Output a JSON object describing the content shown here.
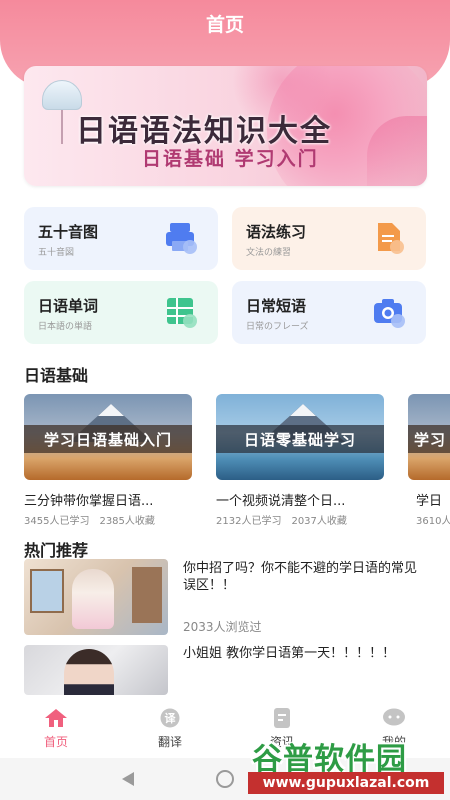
{
  "header": {
    "title": "首页"
  },
  "banner": {
    "title": "日语语法知识大全",
    "subtitle": "日语基础 学习入门"
  },
  "menu_cards": [
    {
      "title": "五十音图",
      "subtitle": "五十音図",
      "icon": "printer-icon",
      "bg": "#eef3fd",
      "color": "#4f7cf0"
    },
    {
      "title": "语法练习",
      "subtitle": "文法の練習",
      "icon": "document-icon",
      "bg": "#fdf1e8",
      "color": "#f39a4a"
    },
    {
      "title": "日语单词",
      "subtitle": "日本語の単語",
      "icon": "grid-icon",
      "bg": "#ebf9f3",
      "color": "#3fc48e"
    },
    {
      "title": "日常短语",
      "subtitle": "日常のフレーズ",
      "icon": "camera-icon",
      "bg": "#eef3fd",
      "color": "#4f7cf0"
    }
  ],
  "section_basics": {
    "title": "日语基础"
  },
  "courses": [
    {
      "banner": "学习日语基础入门",
      "title": "三分钟带你掌握日语...",
      "learners": "3455人已学习",
      "favorites": "2385人收藏"
    },
    {
      "banner": "日语零基础学习",
      "title": "一个视频说清整个日...",
      "learners": "2132人已学习",
      "favorites": "2037人收藏"
    },
    {
      "banner": "学习",
      "title": "学日",
      "learners": "3610人",
      "favorites": ""
    }
  ],
  "section_hot": {
    "title": "热门推荐"
  },
  "recommendations": [
    {
      "title": "你中招了吗？你不能不避的学日语的常见误区！！",
      "views": "2033人浏览过"
    },
    {
      "title": "小姐姐 教你学日语第一天！！！！！",
      "views": ""
    }
  ],
  "tabbar": [
    {
      "label": "首页",
      "icon": "home-icon",
      "active": true
    },
    {
      "label": "翻译",
      "icon": "translate-icon",
      "active": false
    },
    {
      "label": "资讯",
      "icon": "news-icon",
      "active": false
    },
    {
      "label": "我的",
      "icon": "chat-icon",
      "active": false
    }
  ],
  "watermark": {
    "name": "谷普软件园",
    "url": "www.gupuxlazal.com"
  },
  "colors": {
    "primary": "#f58a9c",
    "active_tab": "#f0607e"
  }
}
